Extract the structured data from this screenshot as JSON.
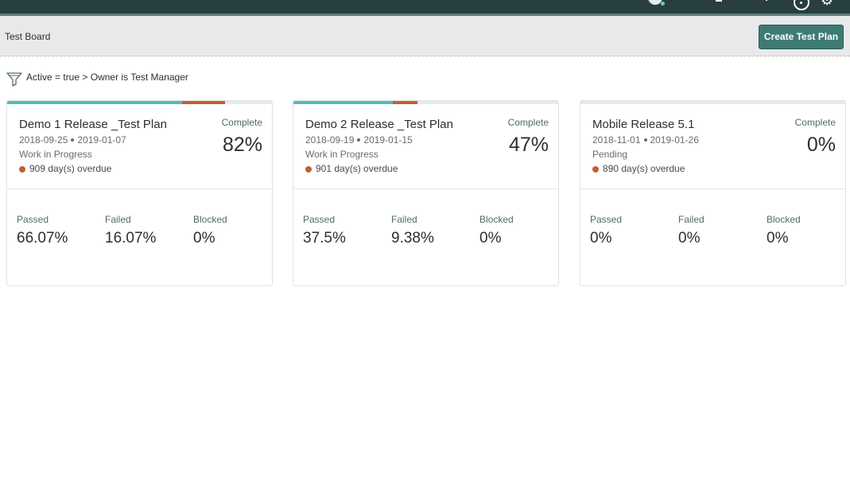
{
  "header": {
    "icons": [
      "avatar",
      "help-icon",
      "gear-icon"
    ]
  },
  "subheader": {
    "title": "Test Board",
    "create_label": "Create Test Plan"
  },
  "filter": {
    "icon": "filter-icon",
    "crumb_1": "Active = true",
    "separator": ">",
    "crumb_2": "Owner is Test Manager"
  },
  "colors": {
    "header": "#293e40",
    "accent": "#3e7a74",
    "passed": "#57bcb4",
    "failed": "#c0622f"
  },
  "cards": [
    {
      "name": "Demo 1 Release _Test Plan",
      "start": "2018-09-25",
      "end": "2019-01-07",
      "state": "Work in Progress",
      "overdue": "909 day(s) overdue",
      "complete_label": "Complete",
      "complete_value": "82%",
      "passed_label": "Passed",
      "passed_value": "66.07%",
      "failed_label": "Failed",
      "failed_value": "16.07%",
      "blocked_label": "Blocked",
      "blocked_value": "0%",
      "bar_passed": 66.07,
      "bar_failed": 16.07
    },
    {
      "name": "Demo 2 Release _Test Plan",
      "start": "2018-09-19",
      "end": "2019-01-15",
      "state": "Work in Progress",
      "overdue": "901 day(s) overdue",
      "complete_label": "Complete",
      "complete_value": "47%",
      "passed_label": "Passed",
      "passed_value": "37.5%",
      "failed_label": "Failed",
      "failed_value": "9.38%",
      "blocked_label": "Blocked",
      "blocked_value": "0%",
      "bar_passed": 37.5,
      "bar_failed": 9.38
    },
    {
      "name": "Mobile Release 5.1",
      "start": "2018-11-01",
      "end": "2019-01-26",
      "state": "Pending",
      "overdue": "890 day(s) overdue",
      "complete_label": "Complete",
      "complete_value": "0%",
      "passed_label": "Passed",
      "passed_value": "0%",
      "failed_label": "Failed",
      "failed_value": "0%",
      "blocked_label": "Blocked",
      "blocked_value": "0%",
      "bar_passed": 0,
      "bar_failed": 0
    }
  ]
}
